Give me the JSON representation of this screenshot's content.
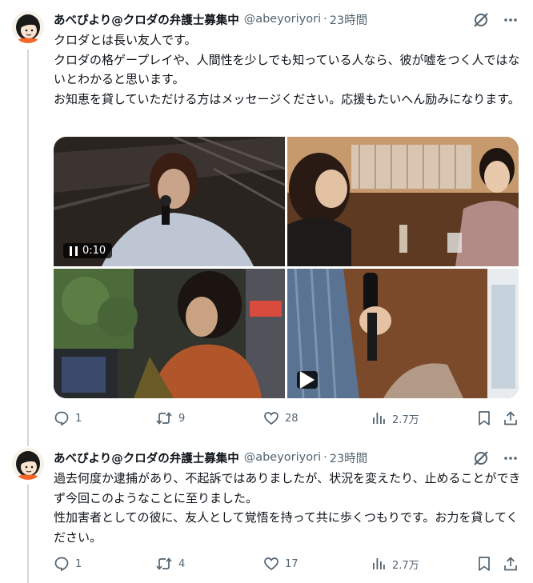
{
  "tweets": [
    {
      "author": {
        "name": "あべぴより@クロダの弁護士募集中",
        "handle": "@abeyoriyori",
        "time": "23時間"
      },
      "text": [
        "クロダとは長い友人です。",
        "クロダの格ゲープレイや、人間性を少しでも知っている人なら、彼が嘘をつく人ではないとわかると思います。",
        "お知恵を貸していただける方はメッセージください。応援もたいへん励みになります。"
      ],
      "media": {
        "video_time": "0:10"
      },
      "stats": {
        "replies": "1",
        "reposts": "9",
        "likes": "28",
        "views": "2.7万"
      }
    },
    {
      "author": {
        "name": "あべぴより@クロダの弁護士募集中",
        "handle": "@abeyoriyori",
        "time": "23時間"
      },
      "text": [
        "過去何度か逮捕があり、不起訴ではありましたが、状況を変えたり、止めることができず今回このようなことに至りました。",
        "性加害者としての彼に、友人として覚悟を持って共に歩くつもりです。お力を貸してください。"
      ],
      "stats": {
        "replies": "1",
        "reposts": "4",
        "likes": "17",
        "views": "2.7万"
      }
    }
  ],
  "icons": {
    "more": "more-dots-icon",
    "grok": "slash-circle-icon",
    "reply": "reply-bubble-icon",
    "repost": "repost-arrows-icon",
    "like": "heart-icon",
    "views": "views-bar-chart-icon",
    "bookmark": "bookmark-icon",
    "share": "share-upload-icon"
  },
  "colors": {
    "text": "#0f1419",
    "secondary": "#536471",
    "thread_line": "#cfd9de",
    "avatar_accent": "#f4662a"
  }
}
